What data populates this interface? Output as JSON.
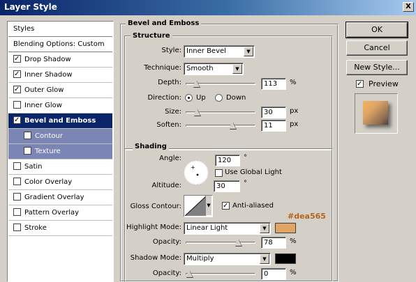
{
  "window": {
    "title": "Layer Style",
    "close_label": "X"
  },
  "left_panel": {
    "items": [
      {
        "label": "Styles",
        "type": "header"
      },
      {
        "label": "Blending Options: Custom",
        "type": "header"
      },
      {
        "label": "Drop Shadow",
        "checked": true
      },
      {
        "label": "Inner Shadow",
        "checked": true
      },
      {
        "label": "Outer Glow",
        "checked": true
      },
      {
        "label": "Inner Glow",
        "checked": false
      },
      {
        "label": "Bevel and Emboss",
        "checked": true,
        "selected": true
      },
      {
        "label": "Contour",
        "checked": false,
        "sub": true
      },
      {
        "label": "Texture",
        "checked": false,
        "sub": true
      },
      {
        "label": "Satin",
        "checked": false
      },
      {
        "label": "Color Overlay",
        "checked": false
      },
      {
        "label": "Gradient Overlay",
        "checked": false
      },
      {
        "label": "Pattern Overlay",
        "checked": false
      },
      {
        "label": "Stroke",
        "checked": false
      }
    ]
  },
  "bevel": {
    "title": "Bevel and Emboss",
    "structure": {
      "title": "Structure",
      "style_label": "Style:",
      "style_value": "Inner Bevel",
      "technique_label": "Technique:",
      "technique_value": "Smooth",
      "depth_label": "Depth:",
      "depth_value": "113",
      "depth_unit": "%",
      "depth_level": 0.113,
      "direction_label": "Direction:",
      "direction_up": "Up",
      "direction_down": "Down",
      "direction_selected": "Up",
      "size_label": "Size:",
      "size_value": "30",
      "size_unit": "px",
      "size_level": 0.12,
      "soften_label": "Soften:",
      "soften_value": "11",
      "soften_unit": "px",
      "soften_level": 0.69
    },
    "shading": {
      "title": "Shading",
      "angle_label": "Angle:",
      "angle_value": "120",
      "angle_unit": "°",
      "global_light_label": "Use Global Light",
      "global_light_checked": false,
      "altitude_label": "Altitude:",
      "altitude_value": "30",
      "altitude_unit": "°",
      "gloss_contour_label": "Gloss Contour:",
      "anti_aliased_label": "Anti-aliased",
      "anti_aliased_checked": true,
      "highlight_mode_label": "Highlight Mode:",
      "highlight_mode_value": "Linear Light",
      "highlight_color": "#dea565",
      "highlight_color_label": "#dea565",
      "highlight_opacity_label": "Opacity:",
      "highlight_opacity_value": "78",
      "highlight_opacity_unit": "%",
      "highlight_opacity_level": 0.78,
      "shadow_mode_label": "Shadow Mode:",
      "shadow_mode_value": "Multiply",
      "shadow_color": "#000000",
      "shadow_opacity_label": "Opacity:",
      "shadow_opacity_value": "0",
      "shadow_opacity_unit": "%",
      "shadow_opacity_level": 0.0
    }
  },
  "buttons": {
    "ok": "OK",
    "cancel": "Cancel",
    "new_style": "New Style...",
    "preview_label": "Preview",
    "preview_checked": true
  },
  "colors": {
    "accent": "#0a246a",
    "sub_item": "#7c86b4",
    "annotation": "#b5651d"
  }
}
